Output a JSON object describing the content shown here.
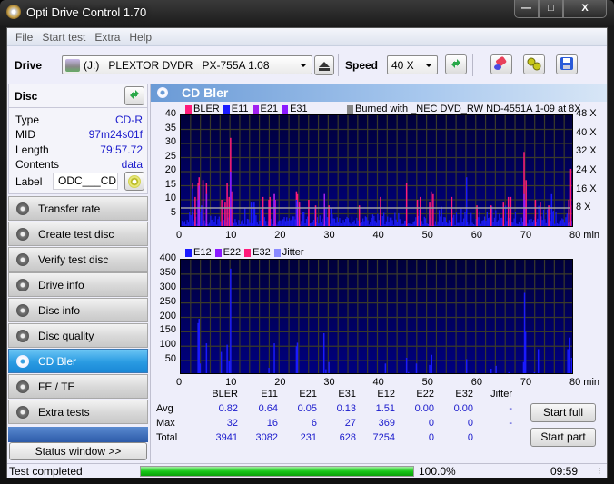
{
  "window": {
    "title": "Opti Drive Control 1.70",
    "controls": [
      "minimize",
      "maximize",
      "close"
    ]
  },
  "menu": [
    "File",
    "Start test",
    "Extra",
    "Help"
  ],
  "toolbar": {
    "drive_label": "Drive",
    "drive_value": "(J:)   PLEXTOR DVDR   PX-755A 1.08",
    "speed_label": "Speed",
    "speed_value": "40 X",
    "icons": [
      "drive-icon",
      "eject-icon",
      "refresh-icon",
      "eraser-icon",
      "settings-icon",
      "save-icon"
    ]
  },
  "disc": {
    "title": "Disc",
    "fields": [
      {
        "key": "Type",
        "value": "CD-R"
      },
      {
        "key": "MID",
        "value": "97m24s01f"
      },
      {
        "key": "Length",
        "value": "79:57.72"
      },
      {
        "key": "Contents",
        "value": "data"
      }
    ],
    "label_key": "Label",
    "label_value": "ODC___CD"
  },
  "nav": [
    {
      "label": "Transfer rate",
      "active": false
    },
    {
      "label": "Create test disc",
      "active": false
    },
    {
      "label": "Verify test disc",
      "active": false
    },
    {
      "label": "Drive info",
      "active": false
    },
    {
      "label": "Disc info",
      "active": false
    },
    {
      "label": "Disc quality",
      "active": false
    },
    {
      "label": "CD Bler",
      "active": true
    },
    {
      "label": "FE / TE",
      "active": false
    },
    {
      "label": "Extra tests",
      "active": false
    }
  ],
  "status_window_label": "Status window >>",
  "main": {
    "title": "CD Bler"
  },
  "colors": {
    "bler": "#ff1a7a",
    "e11": "#1a1aff",
    "e21": "#a020f0",
    "e31": "#8a1aff",
    "e12": "#1a1aff",
    "e22": "#8a1aff",
    "e32": "#ff1a7a",
    "jitter": "#8a8aff",
    "burned": "#888888",
    "speed_line": "#a0a0a0"
  },
  "chart_data": [
    {
      "type": "bar",
      "title": "BLER / E11 / E21 / E31",
      "legend": [
        "BLER",
        "E11",
        "E21",
        "E31"
      ],
      "annotation": "Burned with _NEC DVD_RW ND-4551A 1-09 at 8X",
      "xlabel": "min",
      "xlim": [
        0,
        80
      ],
      "x_ticks": [
        "0",
        "10",
        "20",
        "30",
        "40",
        "50",
        "60",
        "70",
        "80 min"
      ],
      "ylim": [
        0,
        40
      ],
      "y_ticks": [
        "5",
        "10",
        "15",
        "20",
        "25",
        "30",
        "35",
        "40"
      ],
      "y2_ticks": [
        "8 X",
        "16 X",
        "24 X",
        "32 X",
        "40 X",
        "48 X"
      ],
      "y2lim": [
        0,
        48
      ],
      "speed_line_x": 8.5,
      "grid": true,
      "series": [
        {
          "name": "BLER",
          "spikes": [
            [
              2.3,
              16
            ],
            [
              2.8,
              11
            ],
            [
              3.4,
              16
            ],
            [
              3.6,
              18
            ],
            [
              4.4,
              17
            ],
            [
              5.1,
              16
            ],
            [
              8.2,
              10
            ],
            [
              8.9,
              9
            ],
            [
              9.3,
              16
            ],
            [
              9.7,
              11
            ],
            [
              10.0,
              32
            ],
            [
              10.2,
              13
            ],
            [
              16.6,
              11
            ],
            [
              17.8,
              10
            ],
            [
              18.0,
              11
            ],
            [
              18.9,
              12
            ],
            [
              19.1,
              10
            ],
            [
              23.4,
              13
            ],
            [
              23.6,
              12
            ],
            [
              24.0,
              9
            ],
            [
              25.9,
              10
            ],
            [
              27.3,
              8
            ],
            [
              29.1,
              12
            ],
            [
              30.0,
              8
            ],
            [
              36.2,
              8
            ],
            [
              40.5,
              11
            ],
            [
              45.8,
              16
            ],
            [
              48.0,
              10
            ],
            [
              48.6,
              11
            ],
            [
              50.5,
              9
            ],
            [
              50.8,
              13
            ],
            [
              51.2,
              12
            ],
            [
              55.0,
              11
            ],
            [
              60.1,
              8
            ],
            [
              63.0,
              8
            ],
            [
              65.5,
              9
            ],
            [
              66.5,
              11
            ],
            [
              67.0,
              11
            ],
            [
              69.7,
              27
            ],
            [
              70.1,
              17
            ],
            [
              72.0,
              10
            ],
            [
              73.0,
              9
            ],
            [
              74.7,
              8
            ],
            [
              78.8,
              10
            ],
            [
              79.2,
              21
            ],
            [
              79.6,
              8
            ]
          ]
        },
        {
          "name": "E11",
          "spikes": [
            [
              2.3,
              14
            ],
            [
              3.6,
              15
            ],
            [
              4.1,
              8
            ],
            [
              10.0,
              20
            ],
            [
              14.2,
              9
            ],
            [
              14.8,
              9
            ],
            [
              23.4,
              10
            ],
            [
              58.0,
              18
            ],
            [
              75.3,
              12
            ]
          ],
          "baseline_max": 7
        },
        {
          "name": "E21",
          "spikes": [
            [
              3.6,
              15
            ],
            [
              5.1,
              12
            ],
            [
              18.9,
              12
            ],
            [
              23.6,
              9
            ],
            [
              29.1,
              12
            ],
            [
              69.7,
              12
            ]
          ]
        },
        {
          "name": "E31",
          "spikes": [
            [
              3.4,
              10
            ],
            [
              10.0,
              20
            ],
            [
              19.0,
              10
            ],
            [
              69.8,
              10
            ]
          ]
        }
      ]
    },
    {
      "type": "bar",
      "title": "E12 / E22 / E32 / Jitter",
      "legend": [
        "E12",
        "E22",
        "E32",
        "Jitter"
      ],
      "xlabel": "min",
      "xlim": [
        0,
        80
      ],
      "x_ticks": [
        "0",
        "10",
        "20",
        "30",
        "40",
        "50",
        "60",
        "70",
        "80 min"
      ],
      "ylim": [
        0,
        400
      ],
      "y_ticks": [
        "50",
        "100",
        "150",
        "200",
        "250",
        "300",
        "350",
        "400"
      ],
      "grid": true,
      "series": [
        {
          "name": "E12",
          "spikes": [
            [
              3.4,
              180
            ],
            [
              3.6,
              195
            ],
            [
              3.8,
              40
            ],
            [
              5.1,
              110
            ],
            [
              8.1,
              80
            ],
            [
              9.3,
              105
            ],
            [
              9.7,
              50
            ],
            [
              10.0,
              369
            ],
            [
              16.6,
              5
            ],
            [
              17.8,
              25
            ],
            [
              18.9,
              110
            ],
            [
              23.4,
              100
            ],
            [
              23.6,
              112
            ],
            [
              29.0,
              145
            ],
            [
              29.4,
              20
            ],
            [
              30.0,
              45
            ],
            [
              41.5,
              40
            ],
            [
              45.8,
              60
            ],
            [
              46.2,
              10
            ],
            [
              47.8,
              40
            ],
            [
              50.5,
              35
            ],
            [
              50.9,
              70
            ],
            [
              58.0,
              55
            ],
            [
              63.0,
              22
            ],
            [
              64.0,
              32
            ],
            [
              66.6,
              10
            ],
            [
              69.6,
              45
            ],
            [
              69.8,
              285
            ],
            [
              70.0,
              150
            ],
            [
              71.8,
              10
            ],
            [
              72.6,
              90
            ],
            [
              78.6,
              90
            ],
            [
              79.0,
              130
            ],
            [
              79.4,
              60
            ],
            [
              79.9,
              80
            ]
          ]
        },
        {
          "name": "E22",
          "spikes": []
        },
        {
          "name": "E32",
          "spikes": []
        },
        {
          "name": "Jitter",
          "spikes": []
        }
      ]
    }
  ],
  "stats": {
    "columns": [
      "BLER",
      "E11",
      "E21",
      "E31",
      "E12",
      "E22",
      "E32",
      "Jitter"
    ],
    "rows": [
      {
        "label": "Avg",
        "values": [
          "0.82",
          "0.64",
          "0.05",
          "0.13",
          "1.51",
          "0.00",
          "0.00",
          "-"
        ]
      },
      {
        "label": "Max",
        "values": [
          "32",
          "16",
          "6",
          "27",
          "369",
          "0",
          "0",
          "-"
        ]
      },
      {
        "label": "Total",
        "values": [
          "3941",
          "3082",
          "231",
          "628",
          "7254",
          "0",
          "0",
          ""
        ]
      }
    ]
  },
  "buttons": {
    "start_full": "Start full",
    "start_part": "Start part"
  },
  "statusbar": {
    "text": "Test completed",
    "progress": 1.0,
    "progress_text": "100.0%",
    "time": "09:59"
  }
}
